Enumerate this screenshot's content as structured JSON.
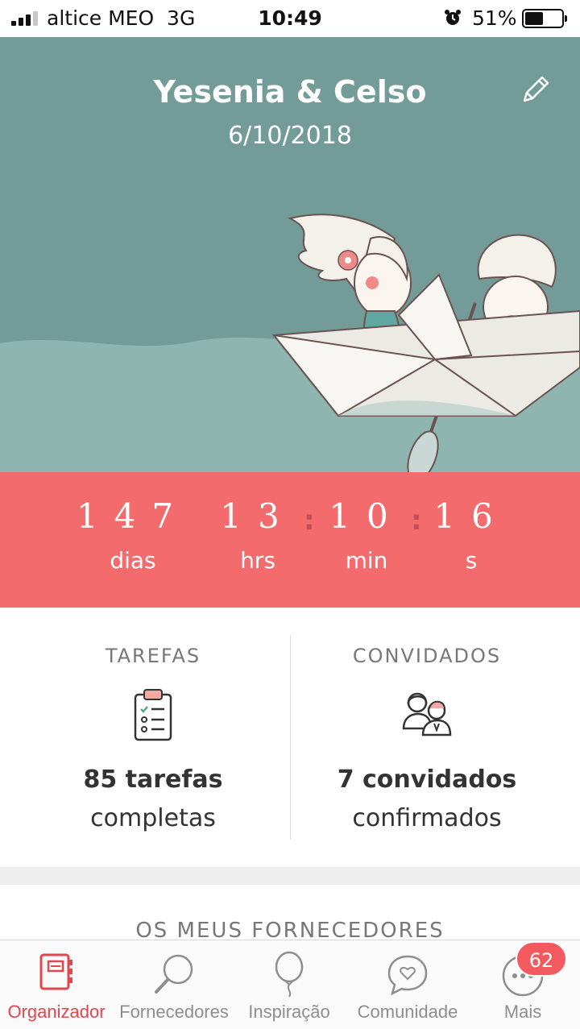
{
  "status_bar": {
    "carrier": "altice MEO",
    "network": "3G",
    "time": "10:49",
    "battery_percent": "51%",
    "battery_level": 0.51,
    "signal_bars": 4,
    "signal_bars_active": 3
  },
  "hero": {
    "couple_names": "Yesenia & Celso",
    "wedding_date": "6/10/2018",
    "edit_icon": "pencil-icon",
    "background_color": "#739c98"
  },
  "countdown": {
    "days": "147",
    "days_label": "dias",
    "hours": "13",
    "hours_label": "hrs",
    "minutes": "10",
    "minutes_label": "min",
    "seconds": "16",
    "seconds_label": "s",
    "separator": ":",
    "background_color": "#f46b6e"
  },
  "stats": {
    "tasks": {
      "title": "TAREFAS",
      "icon": "clipboard-checklist-icon",
      "count": "85 tarefas",
      "subtitle": "completas"
    },
    "guests": {
      "title": "CONVIDADOS",
      "icon": "couple-guests-icon",
      "count": "7 convidados",
      "subtitle": "confirmados"
    }
  },
  "vendors": {
    "title": "OS MEUS FORNECEDORES"
  },
  "tab_bar": {
    "items": [
      {
        "label": "Organizador",
        "icon": "planner-book-icon",
        "active": true
      },
      {
        "label": "Fornecedores",
        "icon": "magnifier-icon",
        "active": false
      },
      {
        "label": "Inspiração",
        "icon": "balloon-icon",
        "active": false
      },
      {
        "label": "Comunidade",
        "icon": "chat-heart-icon",
        "active": false
      },
      {
        "label": "Mais",
        "icon": "more-dots-icon",
        "active": false
      }
    ],
    "badge": "62",
    "active_color": "#e0474e"
  }
}
